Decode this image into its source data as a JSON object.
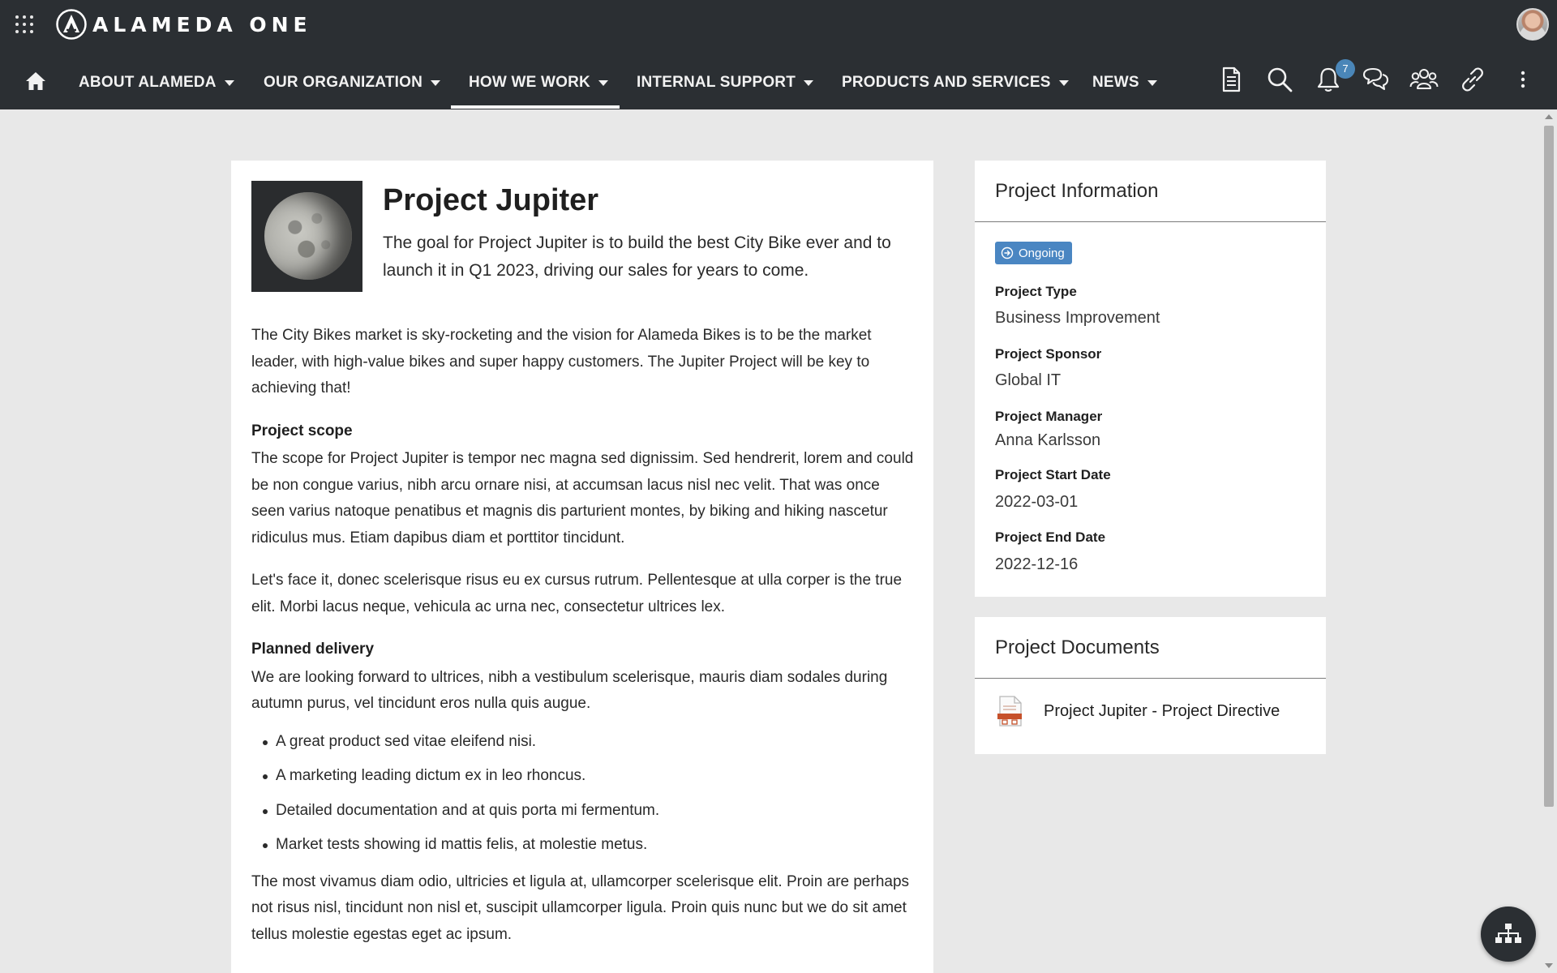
{
  "app": {
    "brand": "ALAMEDA ONE",
    "notification_count": "7"
  },
  "nav": {
    "items": [
      {
        "label": "ABOUT ALAMEDA"
      },
      {
        "label": "OUR ORGANIZATION"
      },
      {
        "label": "HOW WE WORK",
        "active": true
      },
      {
        "label": "INTERNAL SUPPORT"
      },
      {
        "label": "PRODUCTS AND SERVICES"
      },
      {
        "label": "NEWS"
      }
    ]
  },
  "icons": [
    "apps-grid-icon",
    "home-icon",
    "document-icon",
    "search-icon",
    "bell-icon",
    "chat-icon",
    "people-icon",
    "link-icon",
    "more-vertical-icon",
    "sitemap-icon",
    "pdf-icon"
  ],
  "page": {
    "title": "Project Jupiter",
    "lead": "The goal for Project Jupiter is to build the best City Bike ever and to launch it in Q1 2023, driving our sales for years to come.",
    "intro": "The City Bikes market is sky-rocketing and the vision for Alameda Bikes is to be the market leader, with high-value bikes and super happy customers. The Jupiter Project will be key to achieving that!",
    "scope_heading": "Project scope",
    "scope_text": "The scope for Project Jupiter is tempor nec magna sed dignissim. Sed hendrerit, lorem and could be non congue varius, nibh arcu ornare nisi, at accumsan lacus nisl nec velit. That was once seen varius natoque penatibus et magnis dis parturient montes, by biking and hiking nascetur ridiculus mus. Etiam dapibus diam et porttitor tincidunt.",
    "scope_text2": "Let's face it, donec scelerisque risus eu ex cursus rutrum. Pellentesque at ulla corper is the true elit. Morbi lacus neque, vehicula ac urna nec, consectetur ultrices lex.",
    "delivery_heading": "Planned delivery",
    "delivery_text": "We are looking forward to ultrices, nibh a vestibulum scelerisque, mauris diam sodales during autumn purus, vel tincidunt eros nulla quis augue.",
    "bullets": [
      "A great product sed vitae eleifend nisi.",
      "A marketing leading dictum ex in leo rhoncus.",
      "Detailed documentation and at quis porta mi fermentum.",
      "Market tests showing id mattis felis, at molestie metus."
    ],
    "closing": "The most vivamus diam odio, ultricies et ligula at, ullamcorper scelerisque elit. Proin are perhaps not risus nisl, tincidunt non nisl et, suscipit ullamcorper ligula. Proin quis nunc but we do sit amet tellus molestie egestas eget ac ipsum."
  },
  "project_info": {
    "heading": "Project Information",
    "status": "Ongoing",
    "fields": [
      {
        "label": "Project Type",
        "value": "Business Improvement"
      },
      {
        "label": "Project Sponsor",
        "value": "Global IT"
      },
      {
        "label": "Project Manager",
        "value": "Anna Karlsson"
      },
      {
        "label": "Project Start Date",
        "value": "2022-03-01"
      },
      {
        "label": "Project End Date",
        "value": "2022-12-16"
      }
    ]
  },
  "project_documents": {
    "heading": "Project Documents",
    "items": [
      {
        "name": "Project Jupiter - Project Directive",
        "icon": "pdf-icon"
      }
    ]
  },
  "colors": {
    "topbar": "#2b2f33",
    "accent": "#4a86c2",
    "page_bg": "#e8e8e8"
  }
}
